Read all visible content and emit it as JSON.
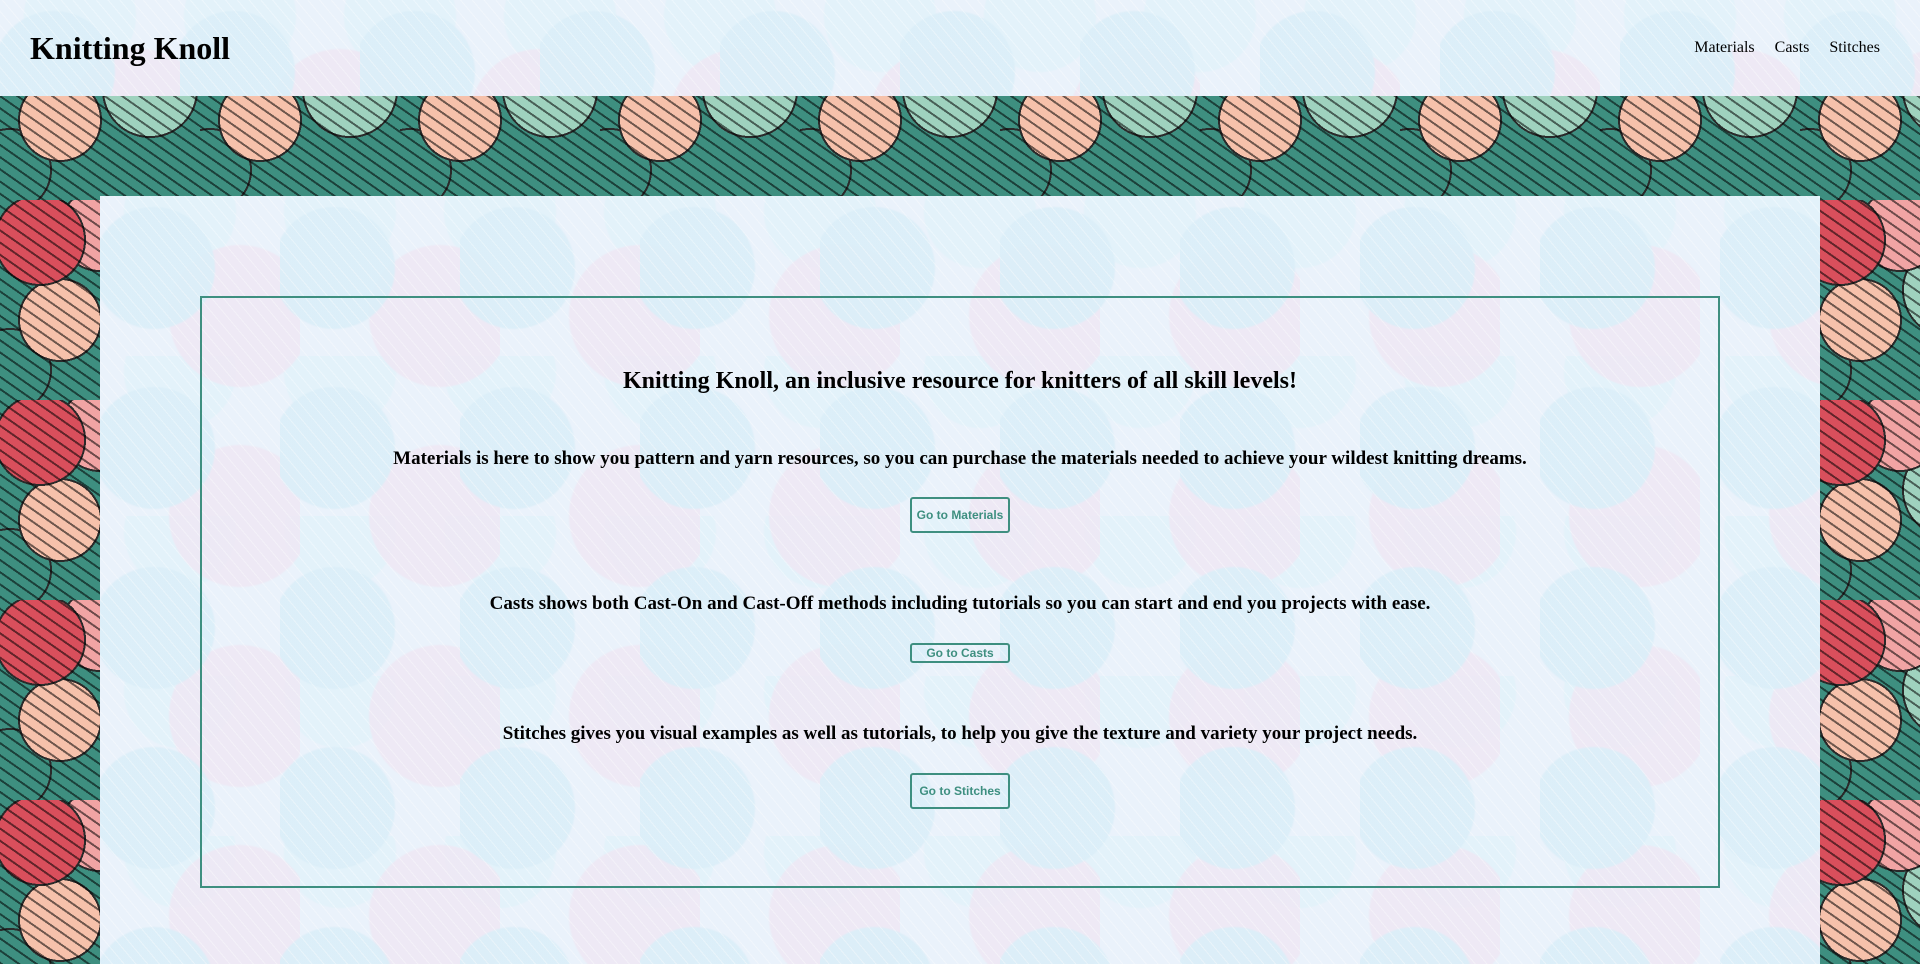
{
  "header": {
    "brand": "Knitting Knoll",
    "nav": [
      {
        "label": "Materials"
      },
      {
        "label": "Casts"
      },
      {
        "label": "Stitches"
      }
    ]
  },
  "main": {
    "headline": "Knitting Knoll, an inclusive resource for knitters of all skill levels!",
    "sections": [
      {
        "text": "Materials is here to show you pattern and yarn resources, so you can purchase the materials needed to achieve your wildest knitting dreams.",
        "button": "Go to Materials"
      },
      {
        "text": "Casts shows both Cast-On and Cast-Off methods including tutorials so you can start and end you projects with ease.",
        "button": "Go to Casts"
      },
      {
        "text": "Stitches gives you visual examples as well as tutorials, to help you give the texture and variety your project needs.",
        "button": "Go to Stitches"
      }
    ]
  },
  "colors": {
    "accent": "#3e8f80",
    "panel_bg": "#eaf2fb",
    "yarn_red": "#d94f5c",
    "yarn_pink": "#ea7b92",
    "yarn_peach": "#f6c1ab",
    "yarn_mint": "#9fd2be",
    "yarn_teal": "#3e8f80"
  }
}
